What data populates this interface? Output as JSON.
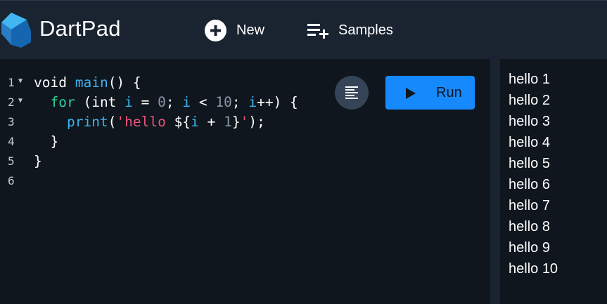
{
  "header": {
    "app_title": "DartPad",
    "new_label": "New",
    "samples_label": "Samples"
  },
  "editor": {
    "line_numbers": [
      "1",
      "2",
      "3",
      "4",
      "5",
      "6"
    ],
    "code": {
      "l1": {
        "void": "void",
        "main": "main",
        "rest": "() {"
      },
      "l2": {
        "indent": "  ",
        "for": "for",
        "open": " (int ",
        "i1": "i",
        "eq": " = ",
        "zero": "0",
        "semi1": "; ",
        "i2": "i",
        "lt": " < ",
        "ten": "10",
        "semi2": "; ",
        "i3": "i",
        "rest": "++) {"
      },
      "l3": {
        "indent": "    ",
        "print": "print",
        "open": "(",
        "str": "'hello ",
        "interp_open": "${",
        "i": "i",
        "plus": " + ",
        "one": "1",
        "interp_close": "}",
        "str_close": "'",
        "close": ");"
      },
      "l4": "  }",
      "l5": "}"
    }
  },
  "toolbar": {
    "run_label": "Run"
  },
  "console": {
    "lines": [
      "hello 1",
      "hello 2",
      "hello 3",
      "hello 4",
      "hello 5",
      "hello 6",
      "hello 7",
      "hello 8",
      "hello 9",
      "hello 10"
    ]
  },
  "colors": {
    "header_bg": "#1a2431",
    "editor_bg": "#0f161e",
    "run_button": "#168afd",
    "keyword_blue": "#3db3ee",
    "control_green": "#34d399",
    "string_pink": "#e8557a"
  },
  "icons": {
    "logo": "dart-logo-icon",
    "new": "add-circle-icon",
    "samples": "playlist-add-icon",
    "format": "format-align-icon",
    "run": "play-icon",
    "fold": "fold-arrow-icon"
  }
}
